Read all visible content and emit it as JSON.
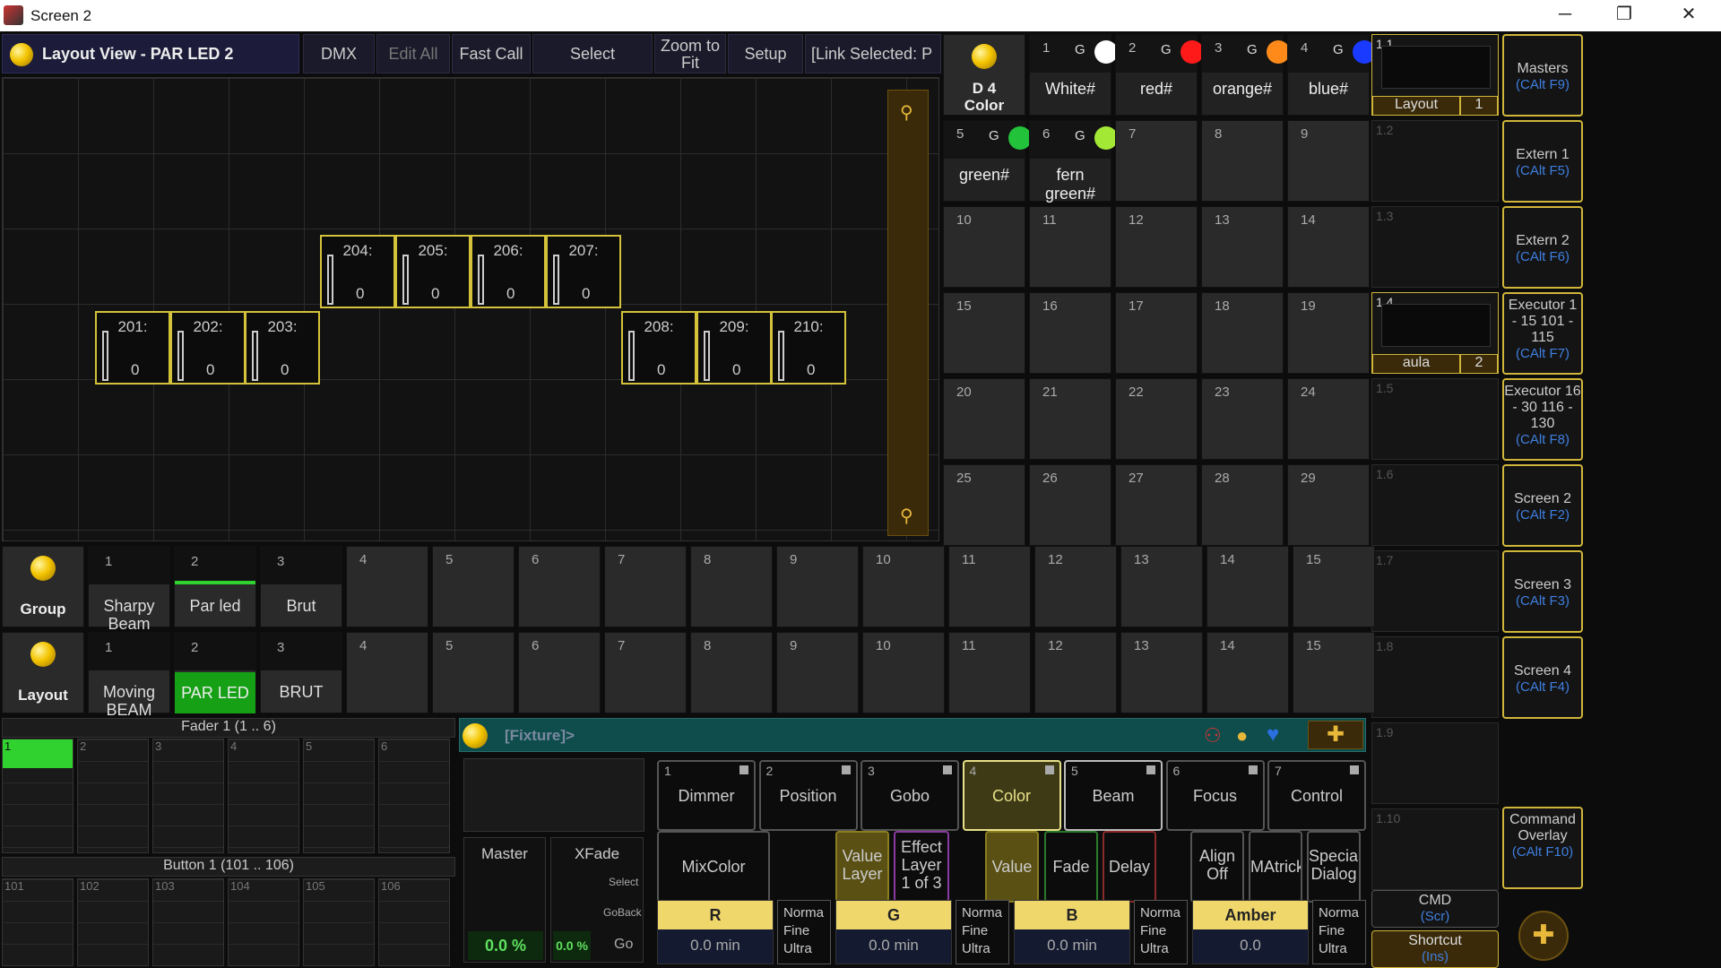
{
  "window": {
    "title": "Screen 2",
    "min": "─",
    "restore": "❐",
    "close": "✕"
  },
  "toolbar": {
    "title": "Layout View - PAR LED 2",
    "buttons": [
      "DMX",
      "Edit All",
      "Fast Call",
      "Select",
      "Zoom to Fit",
      "Setup",
      "[Link Selected: P"
    ]
  },
  "fixtures": [
    {
      "label": "204:",
      "value": "0"
    },
    {
      "label": "205:",
      "value": "0"
    },
    {
      "label": "206:",
      "value": "0"
    },
    {
      "label": "207:",
      "value": "0"
    },
    {
      "label": "201:",
      "value": "0"
    },
    {
      "label": "202:",
      "value": "0"
    },
    {
      "label": "203:",
      "value": "0"
    },
    {
      "label": "208:",
      "value": "0"
    },
    {
      "label": "209:",
      "value": "0"
    },
    {
      "label": "210:",
      "value": "0"
    }
  ],
  "colors": {
    "pool_label": "D 4\nColor",
    "items": [
      {
        "num": "1",
        "g": "G",
        "label": "White#",
        "color": "#ffffff"
      },
      {
        "num": "2",
        "g": "G",
        "label": "red#",
        "color": "#ff1a1a"
      },
      {
        "num": "3",
        "g": "G",
        "label": "orange#",
        "color": "#ff8a1a"
      },
      {
        "num": "4",
        "g": "G",
        "label": "blue#",
        "color": "#1a3aff"
      },
      {
        "num": "5",
        "g": "G",
        "label": "green#",
        "color": "#22c23a"
      },
      {
        "num": "6",
        "g": "G",
        "label": "fern green#",
        "color": "#a4e836"
      }
    ],
    "empty": [
      "7",
      "8",
      "9",
      "10",
      "11",
      "12",
      "13",
      "14",
      "15",
      "16",
      "17",
      "18",
      "19",
      "20",
      "21",
      "22",
      "23",
      "24",
      "25",
      "26",
      "27",
      "28",
      "29"
    ]
  },
  "views": {
    "items": [
      {
        "num": "1.1",
        "name": "Layout",
        "page": "1"
      },
      {
        "num": "1.2"
      },
      {
        "num": "1.3"
      },
      {
        "num": "1.4",
        "name": "aula",
        "page": "2"
      },
      {
        "num": "1.5"
      },
      {
        "num": "1.6"
      },
      {
        "num": "1.7"
      },
      {
        "num": "1.8"
      },
      {
        "num": "1.9"
      },
      {
        "num": "1.10"
      }
    ],
    "cmd": "CMD",
    "cmd_key": "(Scr)",
    "shortcut": "Shortcut",
    "shortcut_key": "(Ins)"
  },
  "right_buttons": [
    {
      "label": "Masters",
      "key": "(CAlt F9)"
    },
    {
      "label": "Extern 1",
      "key": "(CAlt F5)"
    },
    {
      "label": "Extern 2",
      "key": "(CAlt F6)"
    },
    {
      "label": "Executor 1 - 15 101 - 115",
      "key": "(CAlt F7)"
    },
    {
      "label": "Executor 16 - 30 116 - 130",
      "key": "(CAlt F8)"
    },
    {
      "label": "Screen 2",
      "key": "(CAlt F2)"
    },
    {
      "label": "Screen 3",
      "key": "(CAlt F3)"
    },
    {
      "label": "Screen 4",
      "key": "(CAlt F4)"
    },
    {
      "label": "Command Overlay",
      "key": "(CAlt F10)"
    }
  ],
  "groups": {
    "pool_label": "Group",
    "items": [
      {
        "num": "1",
        "label": "Sharpy Beam"
      },
      {
        "num": "2",
        "label": "Par led"
      },
      {
        "num": "3",
        "label": "Brut"
      }
    ],
    "empty": [
      "4",
      "5",
      "6",
      "7",
      "8",
      "9",
      "10",
      "11",
      "12",
      "13",
      "14",
      "15"
    ]
  },
  "layouts": {
    "pool_label": "Layout",
    "items": [
      {
        "num": "1",
        "label": "Moving BEAM"
      },
      {
        "num": "2",
        "label": "PAR LED"
      },
      {
        "num": "3",
        "label": "BRUT"
      }
    ],
    "empty": [
      "4",
      "5",
      "6",
      "7",
      "8",
      "9",
      "10",
      "11",
      "12",
      "13",
      "14",
      "15"
    ]
  },
  "faders": {
    "title": "Fader 1 (1 .. 6)",
    "nums": [
      "1",
      "2",
      "3",
      "4",
      "5",
      "6"
    ],
    "button_title": "Button 1 (101 .. 106)",
    "button_nums": [
      "101",
      "102",
      "103",
      "104",
      "105",
      "106"
    ]
  },
  "command": {
    "text": "[Fixture]>"
  },
  "master": {
    "label": "Master",
    "value": "0.0 %",
    "xfade": "XFade",
    "xfade_value": "0.0 %",
    "select": "Select",
    "goback": "GoBack",
    "go": "Go"
  },
  "attributes": [
    {
      "num": "1",
      "label": "Dimmer"
    },
    {
      "num": "2",
      "label": "Position"
    },
    {
      "num": "3",
      "label": "Gobo"
    },
    {
      "num": "4",
      "label": "Color"
    },
    {
      "num": "5",
      "label": "Beam"
    },
    {
      "num": "6",
      "label": "Focus"
    },
    {
      "num": "7",
      "label": "Control"
    }
  ],
  "functions": {
    "mixcolor": "MixColor",
    "value_layer": "Value Layer",
    "effect_layer": "Effect Layer 1 of 3",
    "value": "Value",
    "fade": "Fade",
    "delay": "Delay",
    "align": "Align Off",
    "matricks": "MAtricks",
    "special": "Special Dialog"
  },
  "encoders": [
    {
      "name": "R",
      "value": "0.0 min"
    },
    {
      "name": "G",
      "value": "0.0 min"
    },
    {
      "name": "B",
      "value": "0.0 min"
    },
    {
      "name": "Amber",
      "value": "0.0"
    }
  ],
  "encoder_mode": [
    "Norma",
    "Fine",
    "Ultra"
  ]
}
